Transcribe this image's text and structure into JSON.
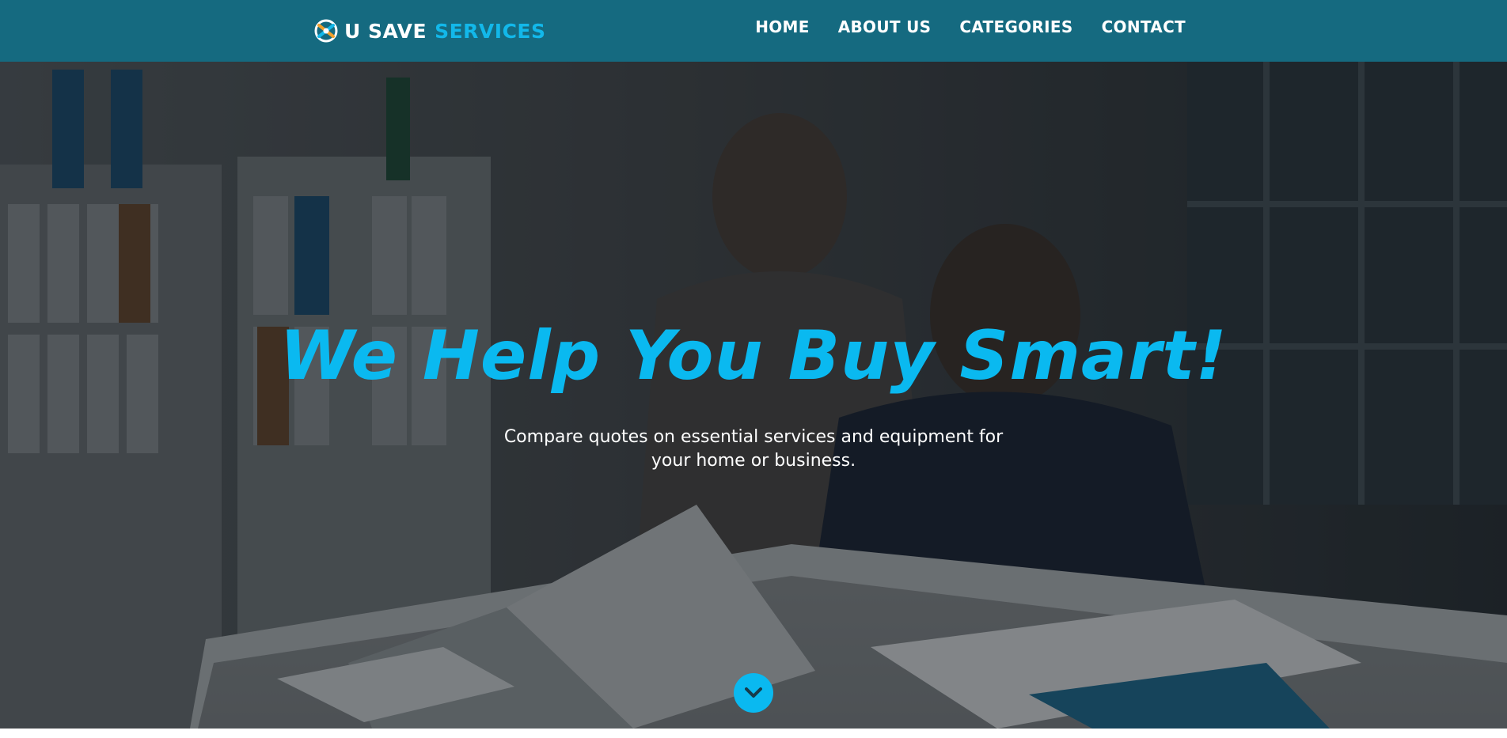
{
  "brand": {
    "word1": "U SAVE",
    "word2": "SERVICES",
    "icon": "logo-mark-icon"
  },
  "nav": {
    "items": [
      "HOME",
      "ABOUT US",
      "CATEGORIES",
      "CONTACT"
    ]
  },
  "hero": {
    "title": "We Help You Buy Smart!",
    "subtitle": "Compare quotes on essential services and equipment for your home or business.",
    "scroll_icon": "chevron-down-icon"
  },
  "colors": {
    "navbar": "#156a80",
    "accent": "#0ab9f0",
    "text": "#ffffff"
  }
}
